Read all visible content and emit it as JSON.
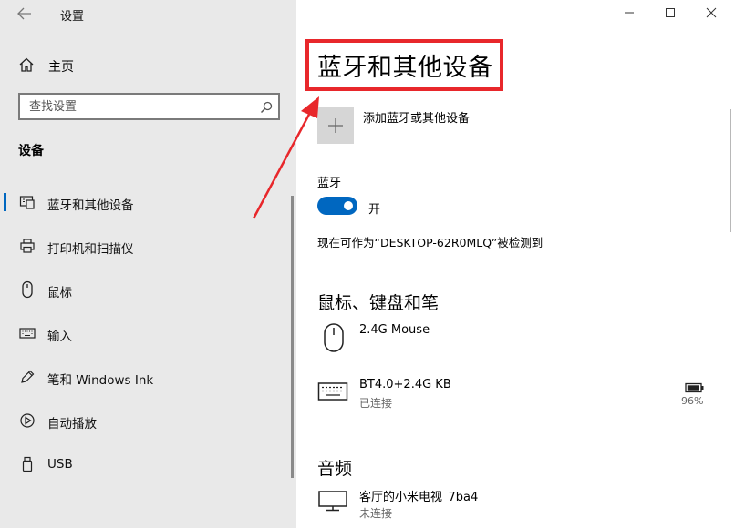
{
  "window": {
    "title": "设置"
  },
  "sidebar": {
    "home": "主页",
    "search_placeholder": "查找设置",
    "section": "设备",
    "items": [
      {
        "label": "蓝牙和其他设备",
        "icon": "bluetooth-devices-icon",
        "active": true
      },
      {
        "label": "打印机和扫描仪",
        "icon": "printer-icon"
      },
      {
        "label": "鼠标",
        "icon": "mouse-icon"
      },
      {
        "label": "输入",
        "icon": "keyboard-icon"
      },
      {
        "label": "笔和 Windows Ink",
        "icon": "pen-icon"
      },
      {
        "label": "自动播放",
        "icon": "autoplay-icon"
      },
      {
        "label": "USB",
        "icon": "usb-icon"
      }
    ]
  },
  "main": {
    "title": "蓝牙和其他设备",
    "add_device": "添加蓝牙或其他设备",
    "bluetooth": {
      "label": "蓝牙",
      "state": "开",
      "on": true,
      "discoverable": "现在可作为“DESKTOP-62R0MLQ”被检测到"
    },
    "input_section": {
      "heading": "鼠标、键盘和笔",
      "devices": [
        {
          "name": "2.4G Mouse",
          "status": "",
          "icon": "mouse-icon"
        },
        {
          "name": "BT4.0+2.4G KB",
          "status": "已连接",
          "battery": "96%",
          "battery_level": 0.96,
          "icon": "keyboard-icon"
        }
      ]
    },
    "audio_section": {
      "heading": "音频",
      "devices": [
        {
          "name": "客厅的小米电视_7ba4",
          "status": "未连接",
          "icon": "monitor-icon"
        }
      ]
    }
  },
  "colors": {
    "accent": "#0067c0",
    "highlight": "#e8272b",
    "sidebar_bg": "#e9e9e9"
  }
}
